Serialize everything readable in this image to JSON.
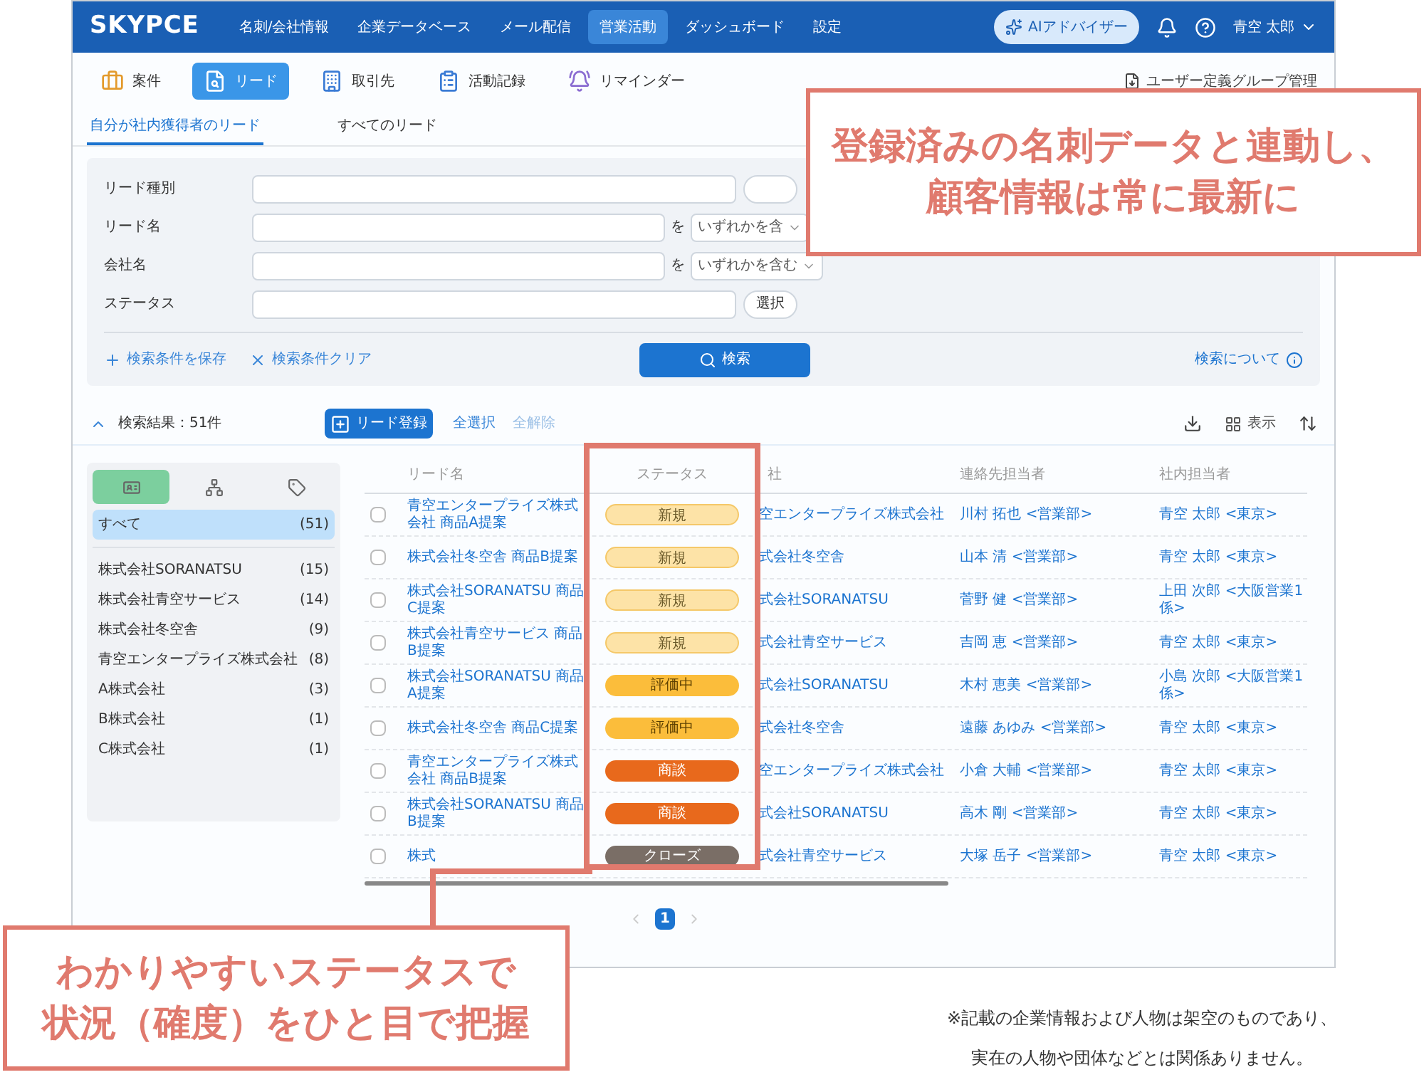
{
  "brand": "SKYPCE",
  "nav": [
    {
      "label": "名刺/会社情報",
      "selected": false
    },
    {
      "label": "企業データベース",
      "selected": false
    },
    {
      "label": "メール配信",
      "selected": false
    },
    {
      "label": "営業活動",
      "selected": true
    },
    {
      "label": "ダッシュボード",
      "selected": false
    },
    {
      "label": "設定",
      "selected": false
    }
  ],
  "ai_button": "AIアドバイザー",
  "user": "青空 太郎",
  "subnav": [
    {
      "label": "案件",
      "kind": "deal",
      "selected": false
    },
    {
      "label": "リード",
      "kind": "lead",
      "selected": true
    },
    {
      "label": "取引先",
      "kind": "client",
      "selected": false
    },
    {
      "label": "活動記録",
      "kind": "activity",
      "selected": false
    },
    {
      "label": "リマインダー",
      "kind": "reminder",
      "selected": false
    }
  ],
  "group_link": "ユーザー定義グループ管理",
  "tabs": [
    {
      "label": "自分が社内獲得者のリード",
      "selected": true
    },
    {
      "label": "すべてのリード",
      "selected": false
    }
  ],
  "search_form": {
    "rows": [
      {
        "label": "リード種別",
        "kind": "button"
      },
      {
        "label": "リード名",
        "kind": "match",
        "connector": "を",
        "option": "いずれかを含"
      },
      {
        "label": "会社名",
        "kind": "match",
        "connector": "を",
        "option": "いずれかを含む"
      },
      {
        "label": "ステータス",
        "kind": "button",
        "button": "選択"
      }
    ],
    "save_link": "検索条件を保存",
    "clear_link": "検索条件クリア",
    "search_button": "検索",
    "help_link": "検索について"
  },
  "results": {
    "count": "検索結果：51件",
    "add_button": "リード登録",
    "select_all": "全選択",
    "deselect_all": {
      "label": "全解除",
      "disabled": true
    },
    "view_button": "表示"
  },
  "groups": {
    "tabs": [
      {
        "kind": "card",
        "selected": true
      },
      {
        "kind": "org",
        "selected": false
      },
      {
        "kind": "tag",
        "selected": false
      }
    ],
    "items": [
      {
        "name": "すべて",
        "count": "(51)",
        "selected": true
      },
      {
        "name": "株式会社SORANATSU",
        "count": "(15)",
        "selected": false
      },
      {
        "name": "株式会社青空サービス",
        "count": "(14)",
        "selected": false
      },
      {
        "name": "株式会社冬空舎",
        "count": "(9)",
        "selected": false
      },
      {
        "name": "青空エンタープライズ株式会社",
        "count": "(8)",
        "selected": false
      },
      {
        "name": "A株式会社",
        "count": "(3)",
        "selected": false
      },
      {
        "name": "B株式会社",
        "count": "(1)",
        "selected": false
      },
      {
        "name": "C株式会社",
        "count": "(1)",
        "selected": false
      }
    ]
  },
  "table": {
    "columns": [
      "リード名",
      "ステータス",
      "社",
      "連絡先担当者",
      "社内担当者"
    ],
    "rows": [
      {
        "checked": false,
        "lead": "青空エンタープライズ株式会社 商品A提案",
        "status": {
          "label": "新規",
          "kind": "new"
        },
        "company": "空エンタープライズ株式会社",
        "contact": "川村 拓也 <営業部>",
        "owner": "青空 太郎 <東京>"
      },
      {
        "checked": false,
        "lead": "株式会社冬空舎 商品B提案",
        "status": {
          "label": "新規",
          "kind": "new"
        },
        "company": "式会社冬空舎",
        "contact": "山本 清 <営業部>",
        "owner": "青空 太郎 <東京>"
      },
      {
        "checked": false,
        "lead": "株式会社SORANATSU 商品C提案",
        "status": {
          "label": "新規",
          "kind": "new"
        },
        "company": "式会社SORANATSU",
        "contact": "菅野 健 <営業部>",
        "owner": "上田 次郎 <大阪営業1係>"
      },
      {
        "checked": false,
        "lead": "株式会社青空サービス 商品B提案",
        "status": {
          "label": "新規",
          "kind": "new"
        },
        "company": "式会社青空サービス",
        "contact": "吉岡 恵 <営業部>",
        "owner": "青空 太郎 <東京>"
      },
      {
        "checked": false,
        "lead": "株式会社SORANATSU 商品A提案",
        "status": {
          "label": "評価中",
          "kind": "evaluating"
        },
        "company": "式会社SORANATSU",
        "contact": "木村 恵美 <営業部>",
        "owner": "小島 次郎 <大阪営業1係>"
      },
      {
        "checked": false,
        "lead": "株式会社冬空舎 商品C提案",
        "status": {
          "label": "評価中",
          "kind": "evaluating"
        },
        "company": "式会社冬空舎",
        "contact": "遠藤 あゆみ <営業部>",
        "owner": "青空 太郎 <東京>"
      },
      {
        "checked": false,
        "lead": "青空エンタープライズ株式会社 商品B提案",
        "status": {
          "label": "商談",
          "kind": "negotiating"
        },
        "company": "空エンタープライズ株式会社",
        "contact": "小倉 大輔 <営業部>",
        "owner": "青空 太郎 <東京>"
      },
      {
        "checked": false,
        "lead": "株式会社SORANATSU 商品B提案",
        "status": {
          "label": "商談",
          "kind": "negotiating"
        },
        "company": "式会社SORANATSU",
        "contact": "高木 剛 <営業部>",
        "owner": "青空 太郎 <東京>"
      },
      {
        "checked": false,
        "lead": "株式",
        "status": {
          "label": "クローズ",
          "kind": "closed"
        },
        "company": "式会社青空サービス",
        "contact": "大塚 岳子 <営業部>",
        "owner": "青空 太郎 <東京>"
      }
    ]
  },
  "pagination": {
    "pages": [
      {
        "label": "1",
        "selected": true
      }
    ]
  },
  "callouts": [
    {
      "lines": [
        "登録済みの名刺データと連動し、",
        "顧客情報は常に最新に"
      ]
    },
    {
      "lines": [
        "わかりやすいステータスで",
        "状況（確度）をひと目で把握"
      ]
    }
  ],
  "footnote": [
    "※記載の企業情報および人物は架空のものであり、",
    "実在の人物や団体などとは関係ありません。"
  ]
}
